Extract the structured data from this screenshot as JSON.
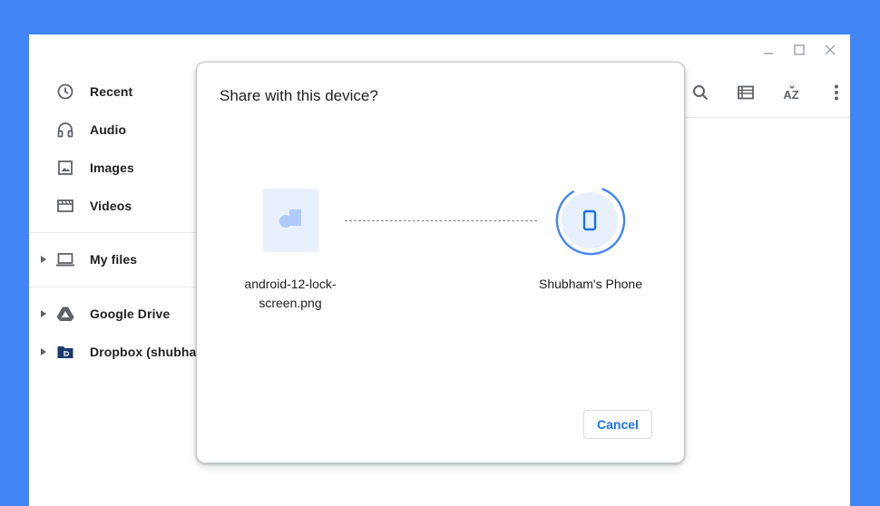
{
  "window": {
    "controls": [
      "minimize-icon",
      "maximize-icon",
      "close-icon"
    ]
  },
  "sidebar": {
    "items": [
      {
        "label": "Recent",
        "icon": "clock-icon"
      },
      {
        "label": "Audio",
        "icon": "headphones-icon"
      },
      {
        "label": "Images",
        "icon": "image-icon"
      },
      {
        "label": "Videos",
        "icon": "film-icon"
      },
      {
        "label": "My files",
        "icon": "laptop-icon"
      },
      {
        "label": "Google Drive",
        "icon": "google-drive-icon"
      },
      {
        "label": "Dropbox (shubham",
        "icon": "dropbox-icon"
      }
    ]
  },
  "toolbar": {
    "icons": [
      "search-icon",
      "list-view-icon",
      "sort-az-icon",
      "more-vert-icon"
    ],
    "sort_label": "AZ"
  },
  "dialog": {
    "title": "Share with this device?",
    "file_name": "android-12-lock-screen.png",
    "device_name": "Shubham's Phone",
    "cancel_label": "Cancel"
  },
  "colors": {
    "background": "#4285f4",
    "accent": "#1a73e8",
    "thumb_bg": "#e8f0fe"
  }
}
